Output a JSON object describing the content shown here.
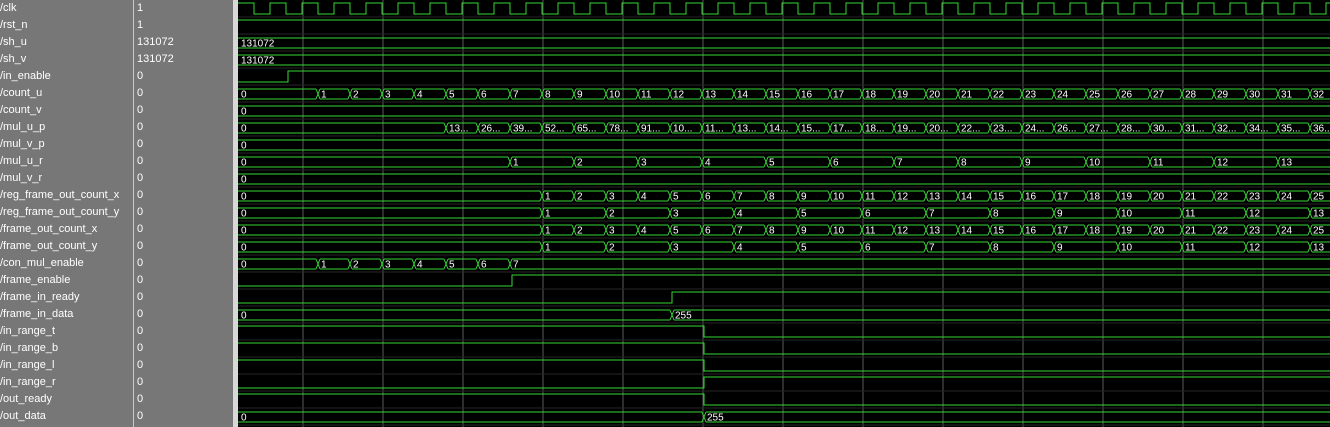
{
  "colors": {
    "panel_bg": "#777777",
    "wave_bg": "#000000",
    "grid": "#5a5a5a",
    "signal": "#35d835",
    "text": "#ffffff"
  },
  "signals": [
    {
      "name": "/clk",
      "value": "1"
    },
    {
      "name": "/rst_n",
      "value": "1"
    },
    {
      "name": "/sh_u",
      "value": "131072"
    },
    {
      "name": "/sh_v",
      "value": "131072"
    },
    {
      "name": "/in_enable",
      "value": "0"
    },
    {
      "name": "/count_u",
      "value": "0"
    },
    {
      "name": "/count_v",
      "value": "0"
    },
    {
      "name": "/mul_u_p",
      "value": "0"
    },
    {
      "name": "/mul_v_p",
      "value": "0"
    },
    {
      "name": "/mul_u_r",
      "value": "0"
    },
    {
      "name": "/mul_v_r",
      "value": "0"
    },
    {
      "name": "/reg_frame_out_count_x",
      "value": "0"
    },
    {
      "name": "/reg_frame_out_count_y",
      "value": "0"
    },
    {
      "name": "/frame_out_count_x",
      "value": "0"
    },
    {
      "name": "/frame_out_count_y",
      "value": "0"
    },
    {
      "name": "/con_mul_enable",
      "value": "0"
    },
    {
      "name": "/frame_enable",
      "value": "0"
    },
    {
      "name": "/frame_in_ready",
      "value": "0"
    },
    {
      "name": "/frame_in_data",
      "value": "0"
    },
    {
      "name": "/in_range_t",
      "value": "0"
    },
    {
      "name": "/in_range_b",
      "value": "0"
    },
    {
      "name": "/in_range_l",
      "value": "0"
    },
    {
      "name": "/in_range_r",
      "value": "0"
    },
    {
      "name": "/out_ready",
      "value": "0"
    },
    {
      "name": "/out_data",
      "value": "0"
    }
  ],
  "waves": {
    "sh_u": [
      "131072"
    ],
    "sh_v": [
      "131072"
    ],
    "count_u": [
      "0",
      "1",
      "2",
      "3",
      "4",
      "5",
      "6",
      "7",
      "8",
      "9",
      "10",
      "11",
      "12",
      "13",
      "14",
      "15",
      "16",
      "17",
      "18",
      "19",
      "20",
      "21",
      "22",
      "23",
      "24",
      "25",
      "26",
      "27",
      "28",
      "29",
      "30",
      "31",
      "32"
    ],
    "count_v": [
      "0"
    ],
    "mul_u_p": [
      "0",
      "13...",
      "26...",
      "39...",
      "52...",
      "65...",
      "78...",
      "91...",
      "10...",
      "11...",
      "13...",
      "14...",
      "15...",
      "17...",
      "18...",
      "19...",
      "20...",
      "22...",
      "23...",
      "24...",
      "26...",
      "27...",
      "28...",
      "30...",
      "31...",
      "32...",
      "34...",
      "35...",
      "36..."
    ],
    "mul_v_p": [
      "0"
    ],
    "mul_u_r": [
      "0",
      "1",
      "2",
      "3",
      "4",
      "5",
      "6",
      "7",
      "8",
      "9",
      "10",
      "11",
      "12",
      "13"
    ],
    "mul_v_r": [
      "0"
    ],
    "reg_frame_out_count_x": [
      "0",
      "1",
      "2",
      "3",
      "4",
      "5",
      "6",
      "7",
      "8",
      "9",
      "10",
      "11",
      "12",
      "13",
      "14",
      "15",
      "16",
      "17",
      "18",
      "19",
      "20",
      "21",
      "22",
      "23",
      "24",
      "25"
    ],
    "reg_frame_out_count_y": [
      "0",
      "1",
      "2",
      "3",
      "4",
      "5",
      "6",
      "7",
      "8",
      "9",
      "10",
      "11",
      "12",
      "13"
    ],
    "frame_out_count_x": [
      "0",
      "1",
      "2",
      "3",
      "4",
      "5",
      "6",
      "7",
      "8",
      "9",
      "10",
      "11",
      "12",
      "13",
      "14",
      "15",
      "16",
      "17",
      "18",
      "19",
      "20",
      "21",
      "22",
      "23",
      "24",
      "25"
    ],
    "frame_out_count_y": [
      "0",
      "1",
      "2",
      "3",
      "4",
      "5",
      "6",
      "7",
      "8",
      "9",
      "10",
      "11",
      "12",
      "13"
    ],
    "con_mul_enable": [
      "0",
      "1",
      "2",
      "3",
      "4",
      "5",
      "6",
      "7"
    ],
    "frame_in_data": [
      "0",
      "255"
    ],
    "out_data": [
      "0",
      "255"
    ]
  }
}
